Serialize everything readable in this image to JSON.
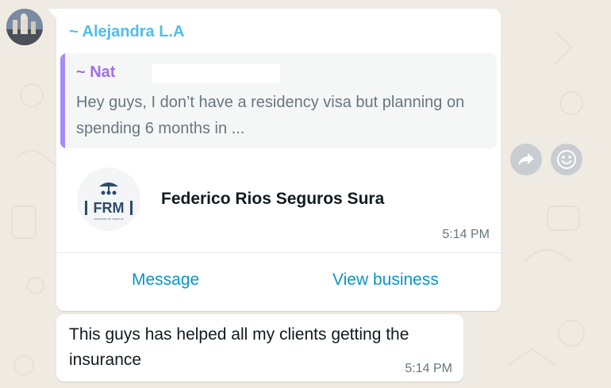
{
  "message": {
    "sender": "~ Alejandra L.A",
    "quoted": {
      "author": "~ Nat",
      "text": "Hey guys, I don’t have a residency visa but planning on spending 6 months in ..."
    },
    "contact_card": {
      "name": "Federico Rios Seguros Sura",
      "logo_text": "FRM",
      "logo_subtext": "asesoras de seguros"
    },
    "time": "5:14 PM",
    "actions": {
      "message_label": "Message",
      "view_business_label": "View business"
    }
  },
  "message2": {
    "text": "This guys has helped all my clients getting the insurance",
    "time": "5:14 PM"
  },
  "hover_actions": {
    "forward_icon": "forward-icon",
    "react_icon": "emoji-icon"
  },
  "colors": {
    "background": "#efeae2",
    "sender_name": "#53bdeb",
    "quote_author": "#a070e8",
    "quote_bar": "#a78bfa",
    "action_link": "#0b94c9"
  }
}
